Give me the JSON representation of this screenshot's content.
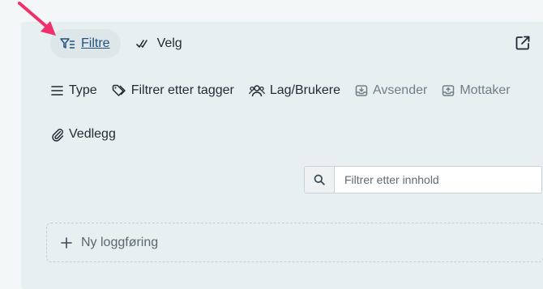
{
  "toolbar": {
    "filter_label": "Filtre",
    "select_label": "Velg"
  },
  "filters": {
    "chips": [
      {
        "label": "Type",
        "icon": "list-icon"
      },
      {
        "label": "Filtrer etter tagger",
        "icon": "tag-icon"
      },
      {
        "label": "Lag/Brukere",
        "icon": "users-icon"
      },
      {
        "label": "Avsender",
        "icon": "inbox-down-icon",
        "muted": true
      },
      {
        "label": "Mottaker",
        "icon": "inbox-up-icon",
        "muted": true
      },
      {
        "label": "Vedlegg",
        "icon": "paperclip-icon"
      }
    ]
  },
  "search": {
    "placeholder": "Filtrer etter innhold"
  },
  "new_entry": {
    "label": "Ny loggføring"
  },
  "colors": {
    "accent": "#23527c",
    "annotation_arrow": "#f0306a"
  }
}
